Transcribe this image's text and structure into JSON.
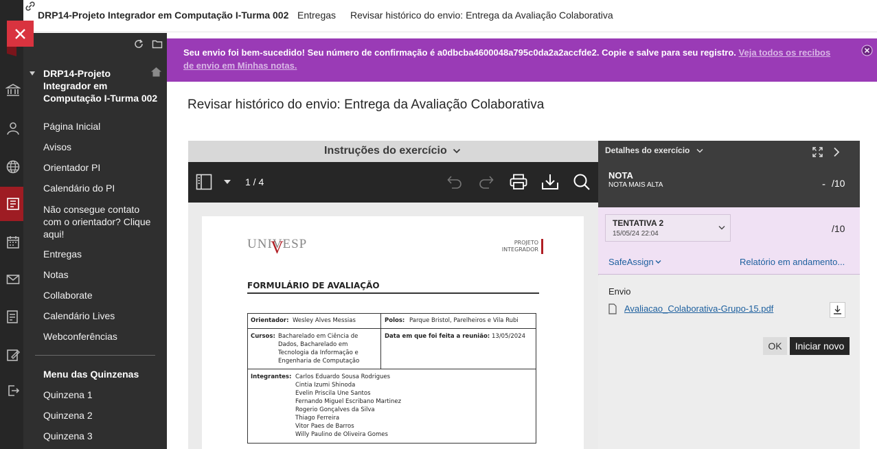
{
  "breadcrumb": {
    "course": "DRP14-Projeto Integrador em Computação I-Turma 002",
    "section": "Entregas",
    "current": "Revisar histórico do envio: Entrega da Avaliação Colaborativa"
  },
  "course_menu": {
    "title": "DRP14-Projeto Integrador em Computação I-Turma 002",
    "items": [
      "Página Inicial",
      "Avisos",
      "Orientador PI",
      "Calendário do PI",
      "Não consegue contato com o orientador? Clique aqui!",
      "Entregas",
      "Notas",
      "Collaborate",
      "Calendário Lives",
      "Webconferências"
    ],
    "section_title": "Menu das Quinzenas",
    "section_items": [
      "Quinzena 1",
      "Quinzena 2",
      "Quinzena 3"
    ]
  },
  "banner": {
    "message": "Seu envio foi bem-sucedido! Seu número de confirmação é a0dbcba4600048a795c0da2a2accfde2. Copie e salve para seu registro.",
    "link": "Veja todos os recibos de envio em Minhas notas."
  },
  "page_title": "Revisar histórico do envio: Entrega da Avaliação Colaborativa",
  "viewer": {
    "instructions_label": "Instruções do exercício",
    "page_indicator": "1 / 4",
    "document": {
      "logo": "UNIVESP",
      "projeto_line1": "PROJETO",
      "projeto_line2": "INTEGRADOR",
      "form_title": "FORMULÁRIO DE AVALIAÇÃO",
      "orientador_label": "Orientador:",
      "orientador_value": "Wesley Alves Messias",
      "polos_label": "Polos:",
      "polos_value": "Parque Bristol, Parelheiros e Vila Rubi",
      "cursos_label": "Cursos:",
      "cursos_lines": [
        "Bacharelado em Ciência de",
        "Dados, Bacharelado em",
        "Tecnologia da Informação e",
        "Engenharia de Computação"
      ],
      "data_label": "Data em que foi feita a reunião:",
      "data_value": "13/05/2024",
      "integrantes_label": "Integrantes:",
      "integrantes": [
        "Carlos Eduardo Sousa Rodrigues",
        "Cintia Izumi Shinoda",
        "Evelin Priscila Une Santos",
        "Fernando Miguel Escribano Martinez",
        "Rogerio Gonçalves da Silva",
        "Thiago Ferreira",
        "Vitor Paes de Barros",
        "Willy Paulino de Oliveira Gomes"
      ]
    }
  },
  "details": {
    "header": "Detalhes do exercício",
    "nota_label": "NOTA",
    "nota_sub": "NOTA MAIS ALTA",
    "nota_value": "-",
    "nota_max": "/10",
    "attempt_label": "TENTATIVA 2",
    "attempt_date": "15/05/24 22:04",
    "attempt_max": "/10",
    "safeassign": "SafeAssign",
    "report": "Relatório em andamento...",
    "envio_label": "Envio",
    "file_name": "Avaliacao_Colaborativa-Grupo-15.pdf",
    "ok_label": "OK",
    "new_label": "Iniciar novo"
  },
  "colors": {
    "banner": "#9a3bb6",
    "close_button": "#d9333f",
    "rail_active": "#9e1c23",
    "link_blue": "#1c5f9e"
  }
}
